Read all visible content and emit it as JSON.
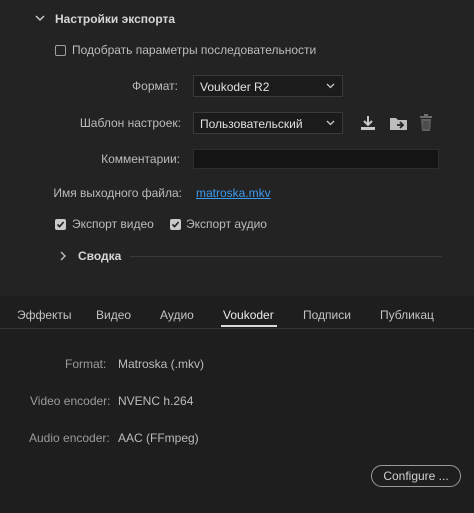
{
  "export_settings": {
    "title": "Настройки экспорта",
    "match_sequence_label": "Подобрать параметры последовательности",
    "format_label": "Формат:",
    "format_value": "Voukoder R2",
    "preset_label": "Шаблон настроек:",
    "preset_value": "Пользовательский",
    "comments_label": "Комментарии:",
    "comments_value": "",
    "output_name_label": "Имя выходного файла:",
    "output_name_value": "matroska.mkv",
    "export_video_label": "Экспорт видео",
    "export_audio_label": "Экспорт аудио",
    "summary_label": "Сводка"
  },
  "tabs": [
    {
      "label": "Эффекты"
    },
    {
      "label": "Видео"
    },
    {
      "label": "Аудио"
    },
    {
      "label": "Voukoder"
    },
    {
      "label": "Подписи"
    },
    {
      "label": "Публикац"
    }
  ],
  "voukoder": {
    "format_label": "Format:",
    "format_value": "Matroska (.mkv)",
    "video_encoder_label": "Video encoder:",
    "video_encoder_value": "NVENC h.264",
    "audio_encoder_label": "Audio encoder:",
    "audio_encoder_value": "AAC (FFmpeg)",
    "configure_label": "Configure ..."
  },
  "icons": {
    "import_preset": "download-icon",
    "save_preset": "folder-arrow-icon",
    "delete_preset": "trash-icon"
  }
}
